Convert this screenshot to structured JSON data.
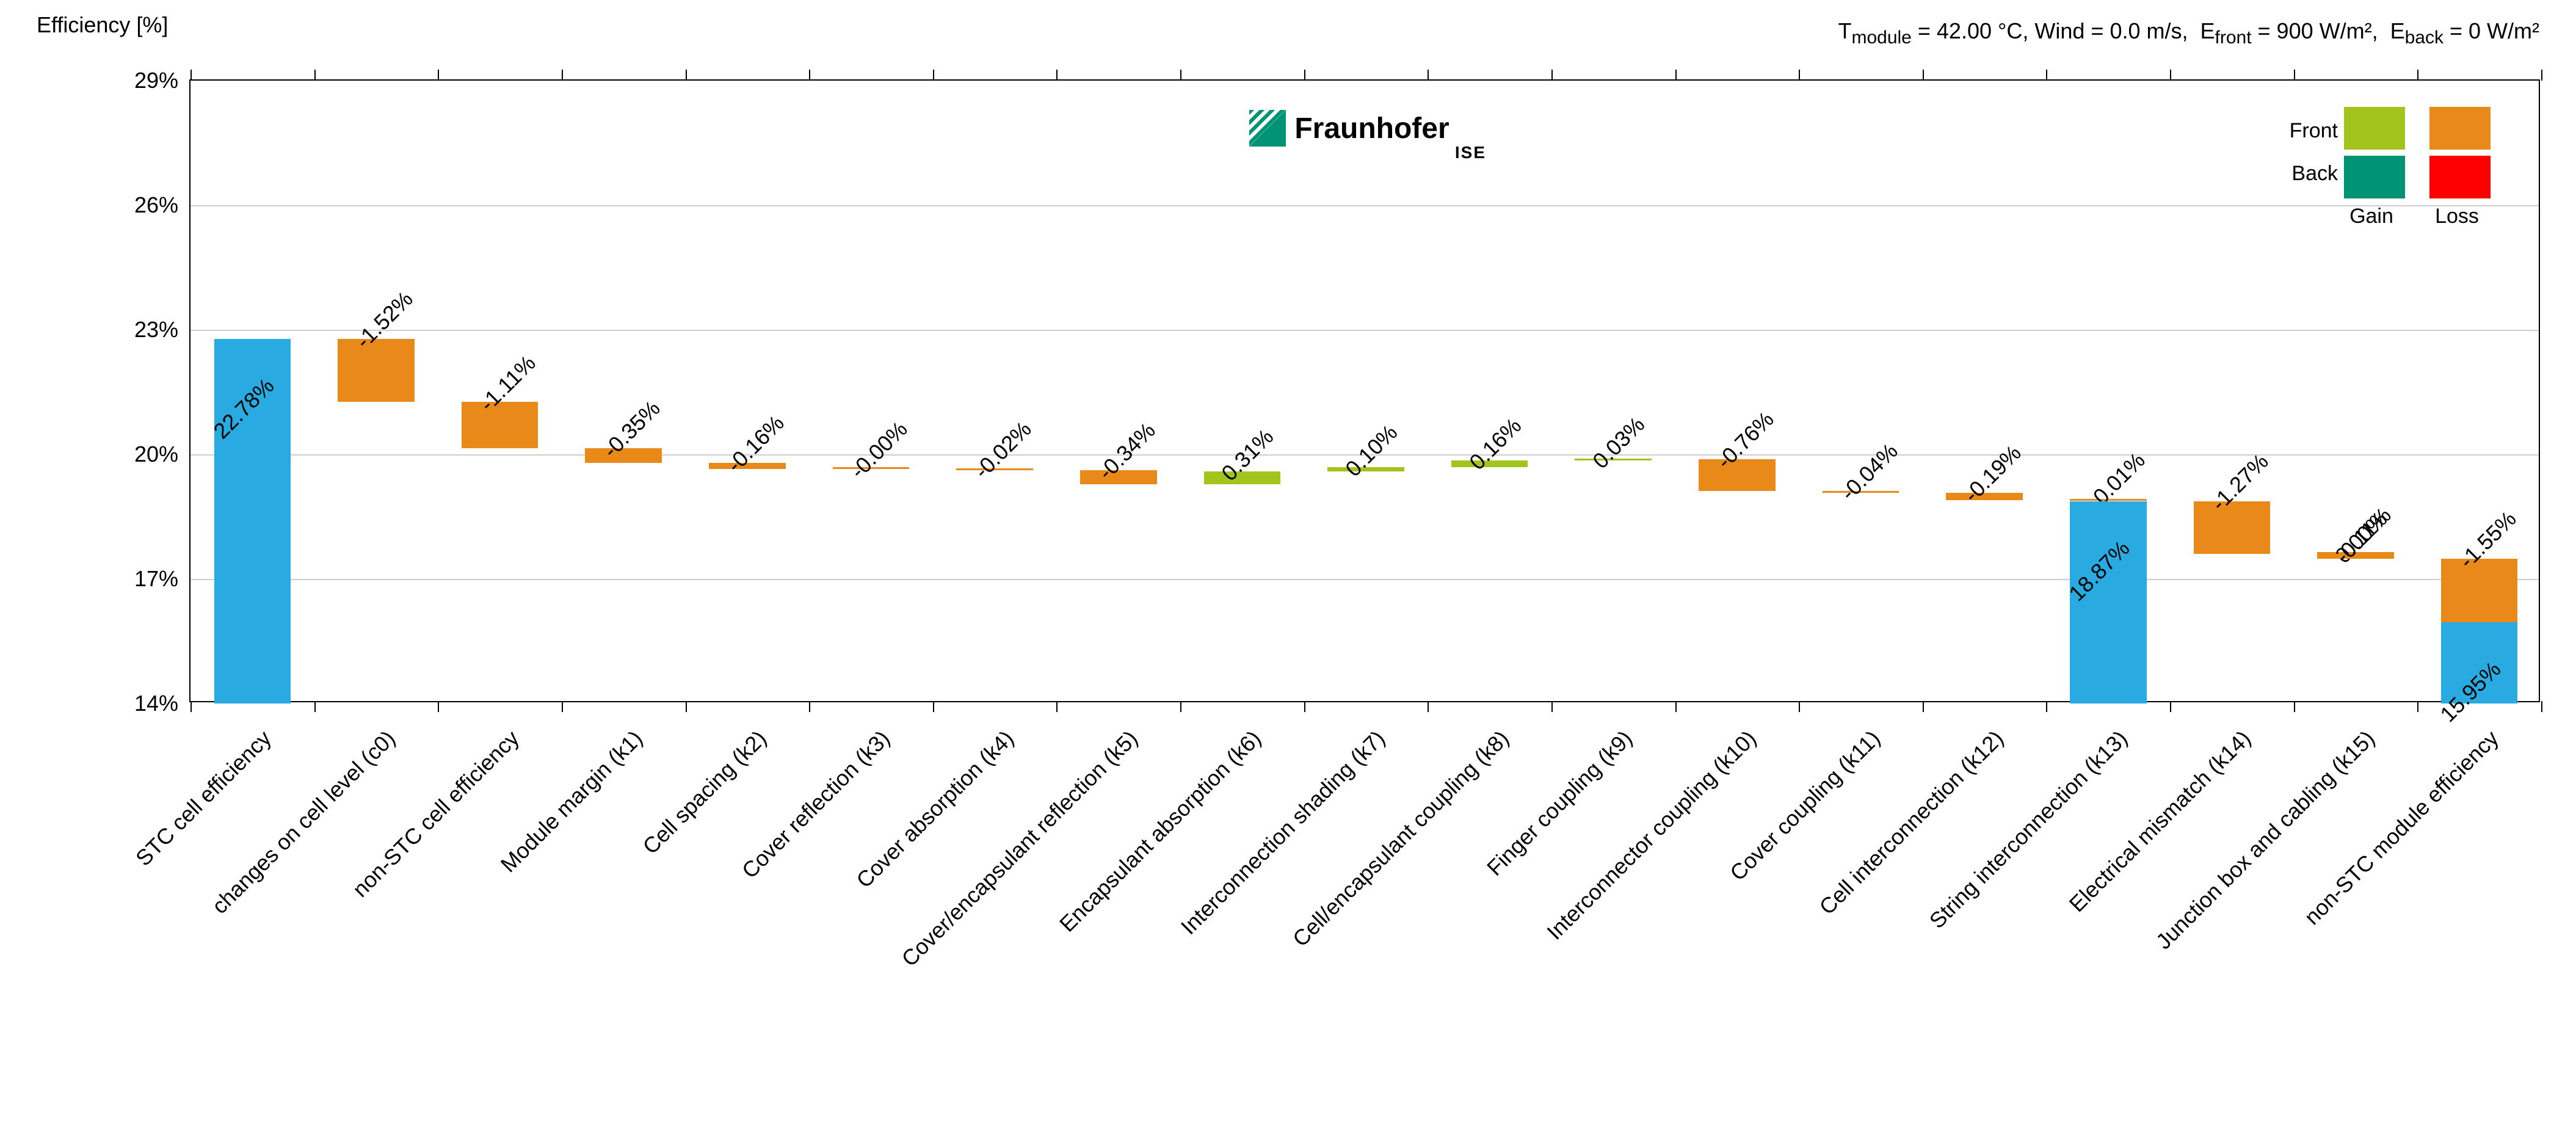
{
  "axis_title": "Efficiency [%]",
  "conditions_html": "T<sub>module</sub> = 42.00 °C, Wind = 0.0 m/s,&nbsp;&nbsp;E<sub>front</sub> = 900 W/m²,&nbsp;&nbsp;E<sub>back</sub> = 0 W/m²",
  "brand": {
    "name": "Fraunhofer",
    "sub": "ISE"
  },
  "legend": {
    "rows": [
      "Front",
      "Back"
    ],
    "cols": [
      "Gain",
      "Loss"
    ],
    "colors": {
      "front_gain": "#a2c41c",
      "front_loss": "#e8891a",
      "back_gain": "#009374",
      "back_loss": "#ff0000"
    }
  },
  "chart_data": {
    "type": "bar",
    "title": "",
    "xlabel": "",
    "ylabel": "Efficiency [%]",
    "ylim": [
      14,
      29
    ],
    "yticks": [
      14,
      17,
      20,
      23,
      26,
      29
    ],
    "ytick_labels": [
      "14%",
      "17%",
      "20%",
      "23%",
      "26%",
      "29%"
    ],
    "categories": [
      "STC cell efficiency",
      "changes on cell level (c0)",
      "non-STC cell efficiency",
      "Module margin (k1)",
      "Cell spacing (k2)",
      "Cover reflection (k3)",
      "Cover absorption (k4)",
      "Cover/encapsulant reflection (k5)",
      "Encapsulant absorption (k6)",
      "Interconnection shading (k7)",
      "Cell/encapsulant coupling (k8)",
      "Finger coupling (k9)",
      "Interconnector coupling (k10)",
      "Cover coupling (k11)",
      "Cell interconnection (k12)",
      "String interconnection (k13)",
      "Electrical mismatch (k14)",
      "Junction box and cabling (k15)",
      "non-STC module efficiency"
    ],
    "bars": [
      {
        "kind": "total",
        "bottom": 14.0,
        "top": 22.78,
        "color": "#29abe2",
        "label": "22.78%",
        "label_inside": true
      },
      {
        "kind": "loss",
        "bottom": 21.26,
        "top": 22.78,
        "color": "#e8891a",
        "label": "-1.52%"
      },
      {
        "kind": "loss",
        "bottom": 20.15,
        "top": 21.26,
        "color": "#e8891a",
        "label": "-1.11%"
      },
      {
        "kind": "loss",
        "bottom": 19.8,
        "top": 20.15,
        "color": "#e8891a",
        "label": "-0.35%"
      },
      {
        "kind": "loss",
        "bottom": 19.64,
        "top": 19.8,
        "color": "#e8891a",
        "label": "-0.16%"
      },
      {
        "kind": "loss",
        "bottom": 19.64,
        "top": 19.64,
        "color": "#e8891a",
        "label": "-0.00%"
      },
      {
        "kind": "loss",
        "bottom": 19.62,
        "top": 19.64,
        "color": "#e8891a",
        "label": "-0.02%"
      },
      {
        "kind": "loss",
        "bottom": 19.28,
        "top": 19.62,
        "color": "#e8891a",
        "label": "-0.34%"
      },
      {
        "kind": "gain",
        "bottom": 19.28,
        "top": 19.59,
        "color": "#a2c41c",
        "label": "0.31%"
      },
      {
        "kind": "gain",
        "bottom": 19.59,
        "top": 19.69,
        "color": "#a2c41c",
        "label": "0.10%"
      },
      {
        "kind": "gain",
        "bottom": 19.69,
        "top": 19.85,
        "color": "#a2c41c",
        "label": "0.16%"
      },
      {
        "kind": "gain",
        "bottom": 19.85,
        "top": 19.88,
        "color": "#a2c41c",
        "label": "0.03%"
      },
      {
        "kind": "loss",
        "bottom": 19.12,
        "top": 19.88,
        "color": "#e8891a",
        "label": "-0.76%"
      },
      {
        "kind": "loss",
        "bottom": 19.08,
        "top": 19.12,
        "color": "#e8891a",
        "label": "-0.04%"
      },
      {
        "kind": "loss",
        "bottom": 18.89,
        "top": 19.08,
        "color": "#e8891a",
        "label": "-0.19%"
      },
      {
        "kind": "loss",
        "bottom": 18.88,
        "top": 18.89,
        "color": "#e8891a",
        "label": "-0.01%"
      },
      {
        "kind": "total",
        "bottom": 14.0,
        "top": 18.87,
        "color": "#29abe2",
        "label": "18.87%",
        "label_inside": true
      },
      {
        "kind": "loss",
        "bottom": 17.6,
        "top": 18.87,
        "color": "#e8891a",
        "label": "-1.27%"
      },
      {
        "kind": "gain",
        "bottom": 17.6,
        "top": 17.6,
        "color": "#e8891a",
        "label": "0.00%"
      },
      {
        "kind": "loss",
        "bottom": 17.49,
        "top": 17.6,
        "color": "#e8891a",
        "label": "-0.11%"
      },
      {
        "kind": "loss",
        "bottom": 15.94,
        "top": 17.49,
        "color": "#e8891a",
        "label": "-1.55%"
      },
      {
        "kind": "total",
        "bottom": 14.0,
        "top": 15.95,
        "color": "#29abe2",
        "label": "15.95%",
        "label_inside": true
      }
    ],
    "slot_map": [
      0,
      1,
      2,
      3,
      4,
      5,
      6,
      7,
      8,
      9,
      10,
      11,
      12,
      13,
      14,
      15,
      15,
      16,
      17,
      17,
      18,
      18
    ]
  }
}
